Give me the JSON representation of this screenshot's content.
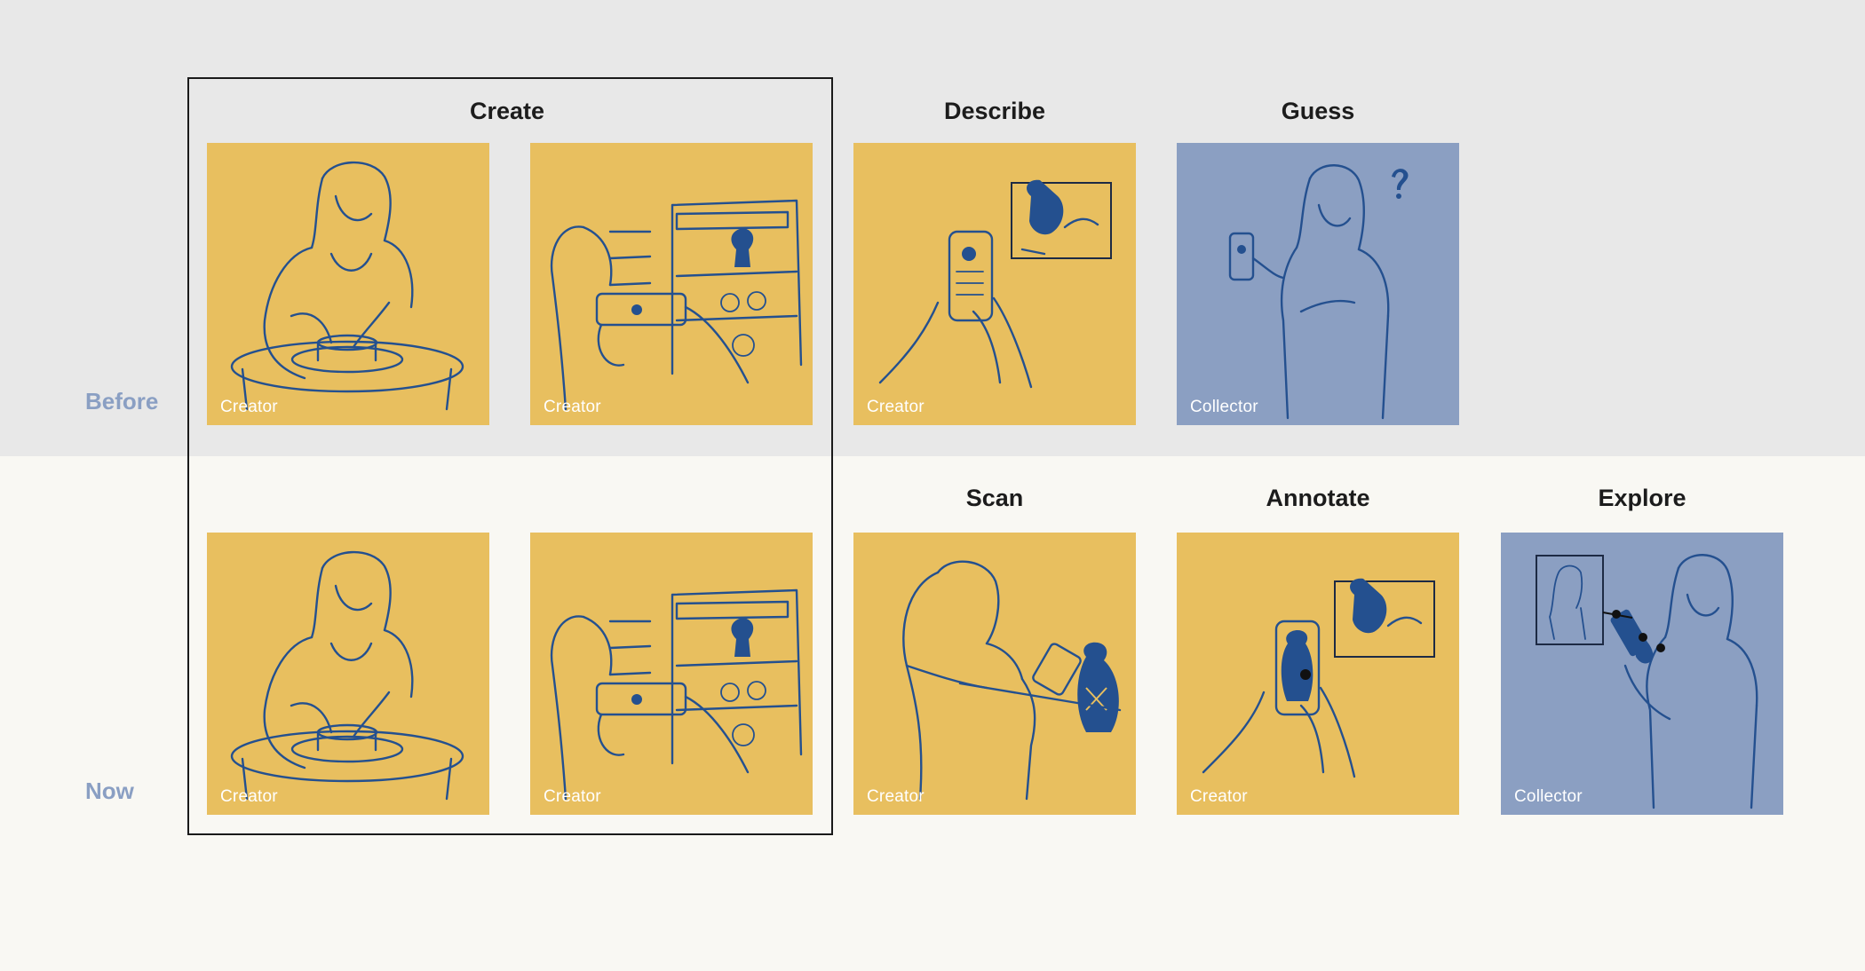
{
  "rows": {
    "before": "Before",
    "now": "Now"
  },
  "columns": {
    "create": "Create",
    "describe": "Describe",
    "guess": "Guess",
    "scan": "Scan",
    "annotate": "Annotate",
    "explore": "Explore"
  },
  "cards": {
    "before": [
      {
        "role": "Creator",
        "icon": "pottery-wheel-illustration"
      },
      {
        "role": "Creator",
        "icon": "photograph-shelf-illustration"
      },
      {
        "role": "Creator",
        "icon": "describe-on-phone-illustration"
      },
      {
        "role": "Collector",
        "icon": "guess-question-illustration"
      }
    ],
    "now": [
      {
        "role": "Creator",
        "icon": "pottery-wheel-illustration"
      },
      {
        "role": "Creator",
        "icon": "photograph-shelf-illustration"
      },
      {
        "role": "Creator",
        "icon": "scan-vase-illustration"
      },
      {
        "role": "Creator",
        "icon": "annotate-on-phone-illustration"
      },
      {
        "role": "Collector",
        "icon": "explore-ar-illustration"
      }
    ]
  },
  "colors": {
    "creator_card": "#e8bf5f",
    "collector_card": "#8b9fc2",
    "line_art": "#24508f",
    "top_band": "#e8e8e8",
    "bottom_band": "#f9f8f3",
    "row_label": "#8a9fc3"
  }
}
